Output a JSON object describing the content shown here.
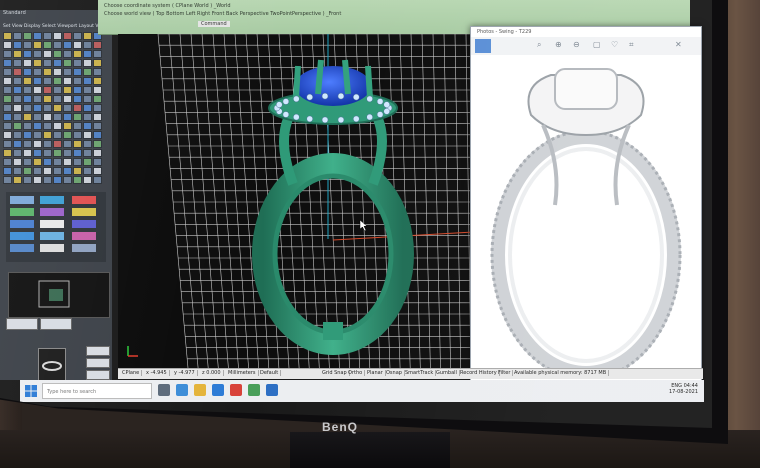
{
  "brand": "BenQ",
  "cad": {
    "command_line_1": "Choose coordinate system ( CPlane World ) _World",
    "command_line_2": "Choose world view ( Top Bottom Left Right Front Back Perspective TwoPointPerspective ) _Front",
    "command_label": "Command",
    "toolbar_title": "Standard",
    "toolbar_tabs": "Set View  Display  Select  Viewport Layout  Visibility  Transform  Curve Tools",
    "viewport_name": "Front"
  },
  "photos": {
    "title": "Photos - Swing - T229",
    "tools": [
      "search-icon",
      "zoom-in-icon",
      "zoom-out-icon",
      "delete-icon",
      "favorite-icon",
      "crop-icon",
      "more-icon"
    ]
  },
  "statusbar": {
    "items": [
      "CPlane",
      "x -4.945",
      "y -4.977",
      "z 0.000",
      "Millimeters",
      "Default",
      "Grid Snap",
      "Ortho",
      "Planar",
      "Osnap",
      "SmartTrack",
      "Gumball",
      "Record History",
      "Filter",
      "Available physical memory: 8717 MB"
    ]
  },
  "taskbar": {
    "search_placeholder": "Type here to search",
    "time": "04:44",
    "date": "17-08-2021",
    "lang": "ENG"
  },
  "colors": {
    "ring": "#2f9a78",
    "gem": "#1f4fd6",
    "grid": "#c8c8c8",
    "cmd_panel": "#b0d3ab"
  }
}
